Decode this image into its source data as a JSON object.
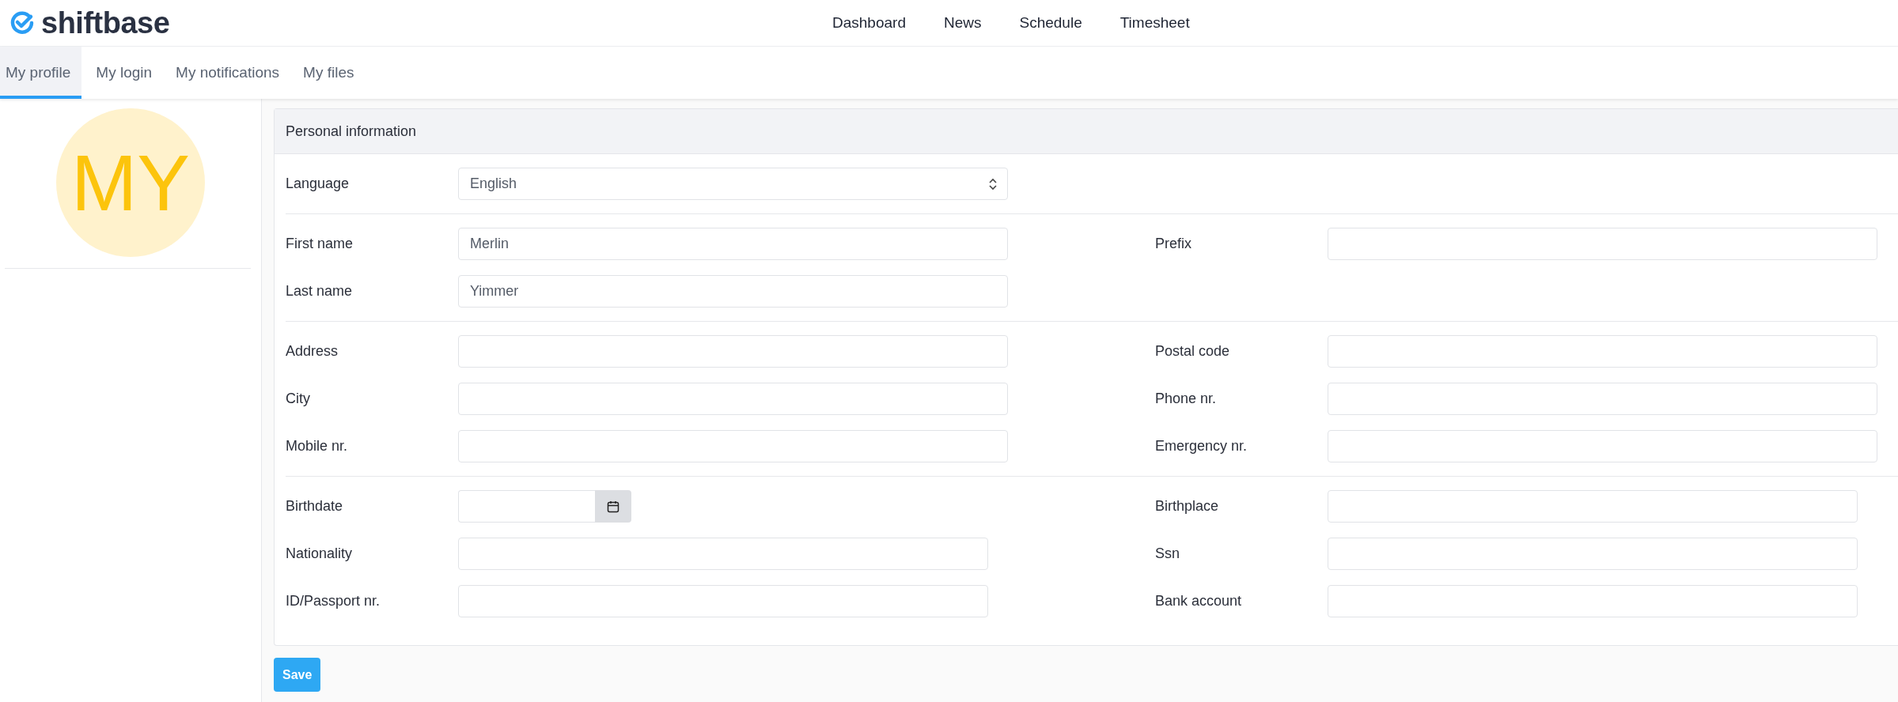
{
  "logo": {
    "text": "shiftbase"
  },
  "nav": [
    "Dashboard",
    "News",
    "Schedule",
    "Timesheet"
  ],
  "tabs": [
    {
      "label": "My profile",
      "selected": true
    },
    {
      "label": "My login",
      "selected": false
    },
    {
      "label": "My notifications",
      "selected": false
    },
    {
      "label": "My files",
      "selected": false
    }
  ],
  "avatar": {
    "initials": "MY"
  },
  "card": {
    "title": "Personal information",
    "sections": [
      {
        "left": [
          {
            "label": "Language",
            "kind": "select",
            "value": "English"
          }
        ]
      },
      {
        "left": [
          {
            "label": "First name",
            "kind": "text",
            "value": "Merlin"
          },
          {
            "label": "Last name",
            "kind": "text",
            "value": "Yimmer"
          }
        ],
        "right": [
          {
            "label": "Prefix",
            "kind": "text"
          }
        ]
      },
      {
        "left": [
          {
            "label": "Address",
            "kind": "text"
          },
          {
            "label": "City",
            "kind": "text"
          },
          {
            "label": "Mobile nr.",
            "kind": "text"
          }
        ],
        "right": [
          {
            "label": "Postal code",
            "kind": "text"
          },
          {
            "label": "Phone nr.",
            "kind": "text"
          },
          {
            "label": "Emergency nr.",
            "kind": "text"
          }
        ]
      },
      {
        "narrow": true,
        "left": [
          {
            "label": "Birthdate",
            "kind": "date"
          },
          {
            "label": "Nationality",
            "kind": "text"
          },
          {
            "label": "ID/Passport nr.",
            "kind": "text"
          }
        ],
        "right": [
          {
            "label": "Birthplace",
            "kind": "text"
          },
          {
            "label": "Ssn",
            "kind": "text"
          },
          {
            "label": "Bank account",
            "kind": "text"
          }
        ]
      }
    ]
  },
  "save_button": "Save"
}
